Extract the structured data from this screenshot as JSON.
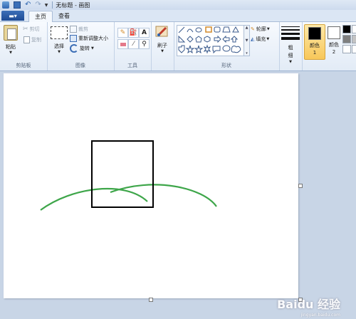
{
  "window": {
    "title": "无标题 - 画图"
  },
  "tabs": {
    "menu_label": "▾",
    "home": "主页",
    "view": "查看"
  },
  "clipboard": {
    "paste": "粘贴",
    "cut": "剪切",
    "copy": "复制",
    "label": "剪贴板"
  },
  "image": {
    "select": "选择",
    "crop": "裁剪",
    "resize": "重新调整大小",
    "rotate": "旋转",
    "label": "图像"
  },
  "tools": {
    "label": "工具",
    "text_tool": "A"
  },
  "brushes": {
    "label": "刷子"
  },
  "shapes": {
    "outline": "轮廓",
    "fill": "填充",
    "label": "形状"
  },
  "size": {
    "label": "粗细"
  },
  "colors": {
    "color1_label": "颜色 1",
    "color2_label": "颜色 2",
    "color1": "#000000",
    "color2": "#ffffff",
    "palette": [
      "#000000",
      "#ffffff",
      "#7f7f7f",
      "#c3c3c3",
      "#880015",
      "#b97a57"
    ]
  },
  "canvas_content": {
    "rect_color": "#000000",
    "curve_color": "#3ea64a"
  },
  "watermark": {
    "main": "Baidu 经验",
    "sub": "jingyan.baidu.com"
  }
}
